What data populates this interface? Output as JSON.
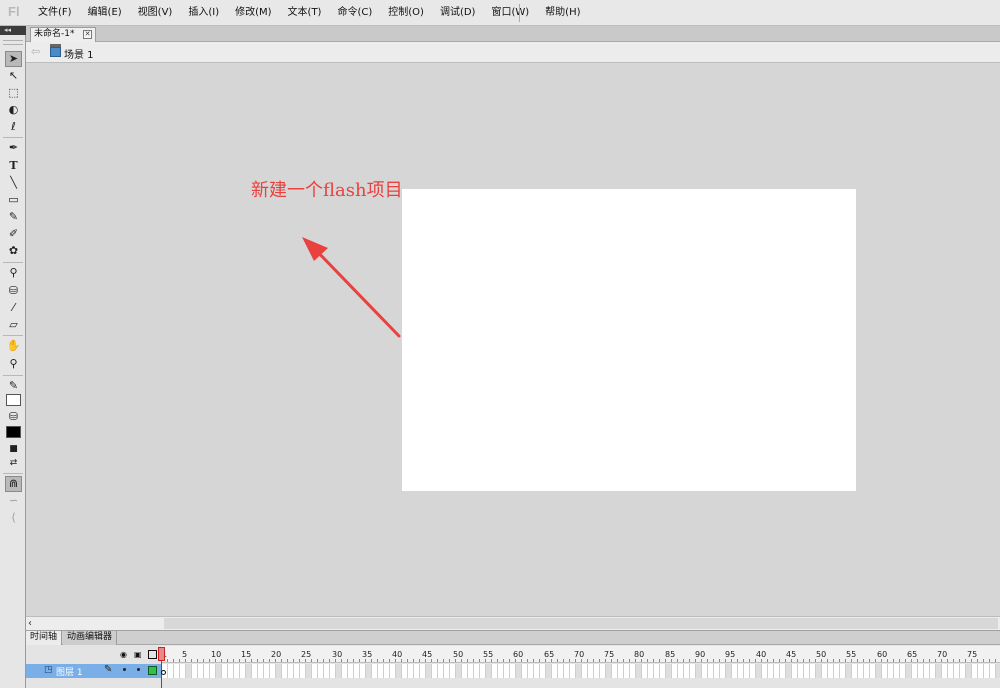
{
  "app": {
    "logo": "Fl"
  },
  "menu": [
    "文件(F)",
    "编辑(E)",
    "视图(V)",
    "插入(I)",
    "修改(M)",
    "文本(T)",
    "命令(C)",
    "控制(O)",
    "调试(D)",
    "窗口(W)",
    "帮助(H)"
  ],
  "document": {
    "tab_title": "未命名-1*",
    "scene_label": "场景 1"
  },
  "stage": {
    "color": "#ffffff",
    "annotation": "新建一个flash项目",
    "annotation_color": "#e8413e"
  },
  "tools": [
    "selection-tool",
    "subselection-tool",
    "free-transform-tool",
    "3d-rotation-tool",
    "lasso-tool",
    "pen-tool",
    "text-tool",
    "line-tool",
    "rectangle-tool",
    "pencil-tool",
    "brush-tool",
    "deco-tool",
    "bone-tool",
    "paint-bucket-tool",
    "eyedropper-tool",
    "eraser-tool",
    "hand-tool",
    "zoom-tool"
  ],
  "colors": {
    "stroke": "#ffffff",
    "fill": "#000000"
  },
  "timeline": {
    "tabs": [
      "时间轴",
      "动画编辑器"
    ],
    "layer_name": "图层 1",
    "frame_numbers": [
      "1",
      "5",
      "10",
      "15",
      "20",
      "25",
      "30",
      "35",
      "40",
      "45",
      "50",
      "55",
      "60",
      "65",
      "70",
      "75",
      "80",
      "85",
      "90",
      "95",
      "40",
      "45",
      "50",
      "55",
      "60",
      "65",
      "70",
      "75"
    ]
  }
}
